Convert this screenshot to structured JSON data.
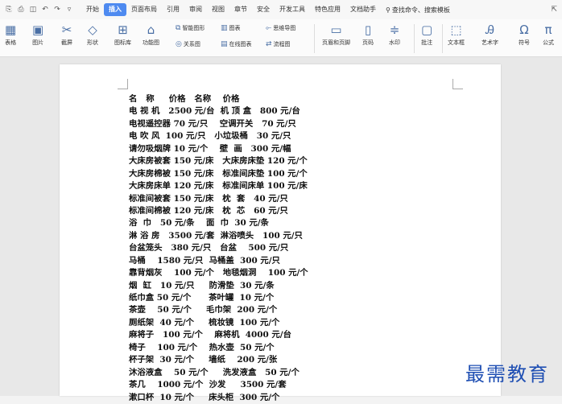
{
  "menubar": {
    "quick_access_icons": [
      "save-icon",
      "print-icon",
      "print-preview-icon",
      "undo-icon",
      "redo-icon",
      "more-icon"
    ],
    "items": [
      "开始",
      "插入",
      "页面布局",
      "引用",
      "审阅",
      "视图",
      "章节",
      "安全",
      "开发工具",
      "特色应用",
      "文档助手"
    ],
    "active_item": "插入",
    "search_label": "查找命令、搜索模板"
  },
  "ribbon": {
    "large_buttons": [
      {
        "label": "表格",
        "icon": "table-icon"
      },
      {
        "label": "图片",
        "icon": "picture-icon"
      },
      {
        "label": "截屏",
        "icon": "screenshot-icon"
      },
      {
        "label": "形状",
        "icon": "shape-icon"
      },
      {
        "label": "图标库",
        "icon": "icon-library-icon"
      },
      {
        "label": "功能图",
        "icon": "function-chart-icon"
      }
    ],
    "small_buttons": [
      {
        "label": "智能图形",
        "icon": "smart-graphic-icon"
      },
      {
        "label": "图表",
        "icon": "chart-icon"
      },
      {
        "label": "思维导图",
        "icon": "mindmap-icon"
      },
      {
        "label": "关系图",
        "icon": "relation-icon"
      },
      {
        "label": "在线图表",
        "icon": "online-chart-icon"
      },
      {
        "label": "流程图",
        "icon": "flowchart-icon"
      }
    ],
    "right_buttons": [
      {
        "label": "页眉和页脚",
        "icon": "header-footer-icon"
      },
      {
        "label": "页码",
        "icon": "page-number-icon"
      },
      {
        "label": "水印",
        "icon": "watermark-icon"
      },
      {
        "label": "批注",
        "icon": "comment-icon"
      },
      {
        "label": "文本框",
        "icon": "textbox-icon"
      },
      {
        "label": "艺术字",
        "icon": "wordart-icon"
      },
      {
        "label": "符号",
        "icon": "symbol-icon"
      },
      {
        "label": "公式",
        "icon": "formula-icon"
      }
    ]
  },
  "document": {
    "lines": [
      "名   称     价格   名称    价格",
      "电 视 机   2500 元/台  机 顶 盒   800 元/台",
      "电视遥控器 70 元/只    空调开关   70 元/只",
      "电 吹 风  100 元/只   小垃圾桶   30 元/只",
      "请勿吸烟牌 10 元/个    壁  画   300 元/幅",
      "大床房被套 150 元/床   大床房床垫 120 元/个",
      "大床房棉被 150 元/床   标准间床垫 100 元/个",
      "大床房床单 120 元/床   标准间床单 100 元/床",
      "标准间被套 150 元/床   枕  套   40 元/只",
      "标准间棉被 120 元/床   枕  芯   60 元/只",
      "浴  巾   50 元/条    面  巾  30 元/条",
      "淋 浴 房   3500 元/套  淋浴喷头   100 元/只",
      "台盆笼头   380 元/只   台盆    500 元/只",
      "马桶    1580 元/只  马桶盖  300 元/只",
      "靠背烟灰    100 元/个   地毯烟洞    100 元/个",
      "烟  缸   10 元/只     防滑垫  30 元/条",
      "纸巾盒 50 元/个      茶叶罐  10 元/个",
      "茶壶    50 元/个     毛巾架  200 元/个",
      "厕纸架  40 元/个     梳妆镜  100 元/个",
      "麻将子   100 元/个    麻将机  4000 元/台",
      "椅子    100 元/个    热水壶  50 元/个",
      "杯子架  30 元/个     墙纸    200 元/张",
      "沐浴液盒    50 元/个     洗发液盒   50 元/个",
      "茶几    1000 元/个  沙发     3500 元/套",
      "漱口杯  10 元/个     床头柜  300 元/个"
    ]
  },
  "watermark": "最需教育"
}
